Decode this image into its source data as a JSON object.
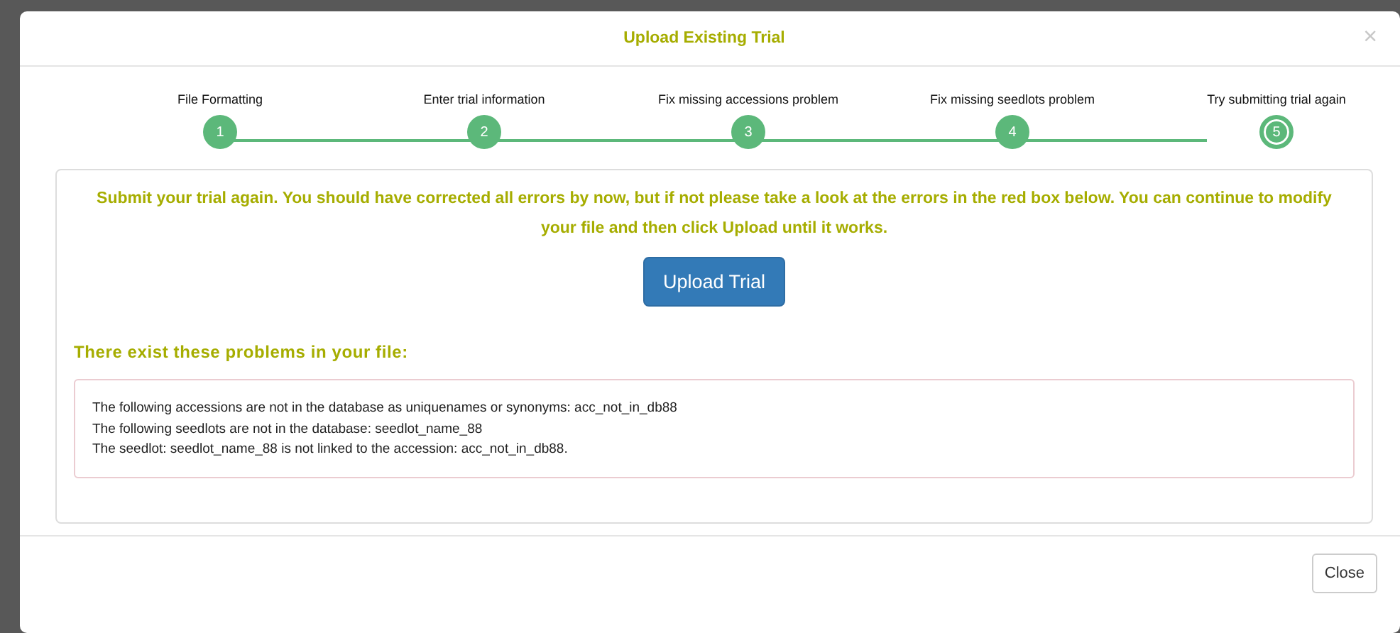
{
  "modal": {
    "title": "Upload Existing Trial",
    "close_icon": "×",
    "steps": [
      {
        "number": "1",
        "label": "File Formatting",
        "current": false
      },
      {
        "number": "2",
        "label": "Enter trial information",
        "current": false
      },
      {
        "number": "3",
        "label": "Fix missing accessions problem",
        "current": false
      },
      {
        "number": "4",
        "label": "Fix missing seedlots problem",
        "current": false
      },
      {
        "number": "5",
        "label": "Try submitting trial again",
        "current": true
      }
    ],
    "message": "Submit your trial again. You should have corrected all errors by now, but if not please take a look at the errors in the red box below. You can continue to modify your file and then click Upload until it works.",
    "upload_button": "Upload Trial",
    "problems_heading": "There exist these problems in your file:",
    "problems": [
      "The following accessions are not in the database as uniquenames or synonyms: acc_not_in_db88",
      "The following seedlots are not in the database: seedlot_name_88",
      "The seedlot: seedlot_name_88 is not linked to the accession: acc_not_in_db88."
    ],
    "footer_button": "Close"
  }
}
